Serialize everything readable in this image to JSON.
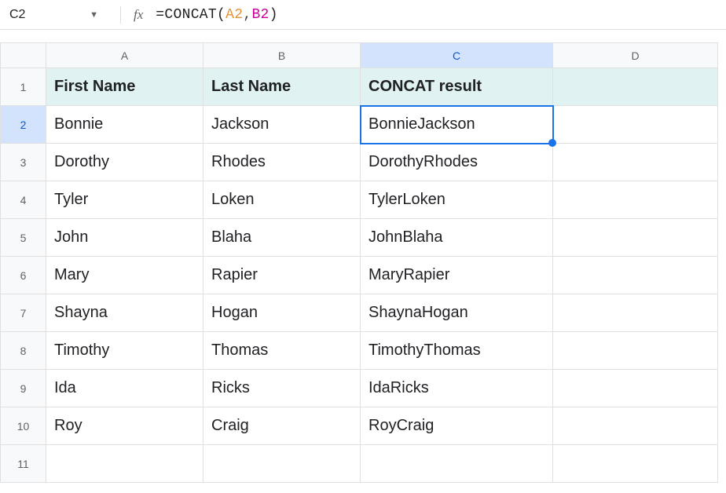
{
  "nameBox": "C2",
  "fxLabel": "fx",
  "formula": {
    "prefix": "=CONCAT(",
    "arg1": "A2",
    "comma": ",",
    "arg2": "B2",
    "suffix": ")"
  },
  "columns": [
    "A",
    "B",
    "C",
    "D"
  ],
  "activeColumnIndex": 2,
  "activeRowIndex": 1,
  "headers": {
    "a": "First Name",
    "b": "Last Name",
    "c": "CONCAT result"
  },
  "rows": [
    {
      "n": "1",
      "a": "First Name",
      "b": "Last Name",
      "c": "CONCAT result",
      "d": "",
      "isHeader": true
    },
    {
      "n": "2",
      "a": "Bonnie",
      "b": "Jackson",
      "c": "BonnieJackson",
      "d": ""
    },
    {
      "n": "3",
      "a": "Dorothy",
      "b": "Rhodes",
      "c": "DorothyRhodes",
      "d": ""
    },
    {
      "n": "4",
      "a": "Tyler",
      "b": "Loken",
      "c": "TylerLoken",
      "d": ""
    },
    {
      "n": "5",
      "a": "John",
      "b": "Blaha",
      "c": "JohnBlaha",
      "d": ""
    },
    {
      "n": "6",
      "a": "Mary",
      "b": "Rapier",
      "c": "MaryRapier",
      "d": ""
    },
    {
      "n": "7",
      "a": "Shayna",
      "b": "Hogan",
      "c": "ShaynaHogan",
      "d": ""
    },
    {
      "n": "8",
      "a": "Timothy",
      "b": "Thomas",
      "c": "TimothyThomas",
      "d": ""
    },
    {
      "n": "9",
      "a": "Ida",
      "b": "Ricks",
      "c": "IdaRicks",
      "d": ""
    },
    {
      "n": "10",
      "a": "Roy",
      "b": "Craig",
      "c": "RoyCraig",
      "d": ""
    },
    {
      "n": "11",
      "a": "",
      "b": "",
      "c": "",
      "d": ""
    }
  ]
}
